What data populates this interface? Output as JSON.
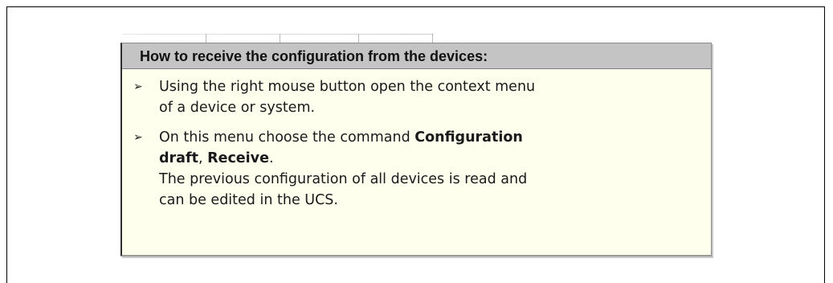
{
  "panel": {
    "title": "How to receive the configuration from the devices:"
  },
  "steps": [
    {
      "bullet_icon": "arrowhead-bullet-icon",
      "line1": "Using the right mouse button open the context menu",
      "line2": "of a device or system."
    },
    {
      "bullet_icon": "arrowhead-bullet-icon",
      "intro": "On this menu choose the command ",
      "cmd1": "Configuration",
      "cmd2": "draft",
      "sep": ", ",
      "cmd3": "Receive",
      "end": ".",
      "line3": "The previous configuration of all devices is read and",
      "line4": "can be edited in the UCS."
    }
  ]
}
